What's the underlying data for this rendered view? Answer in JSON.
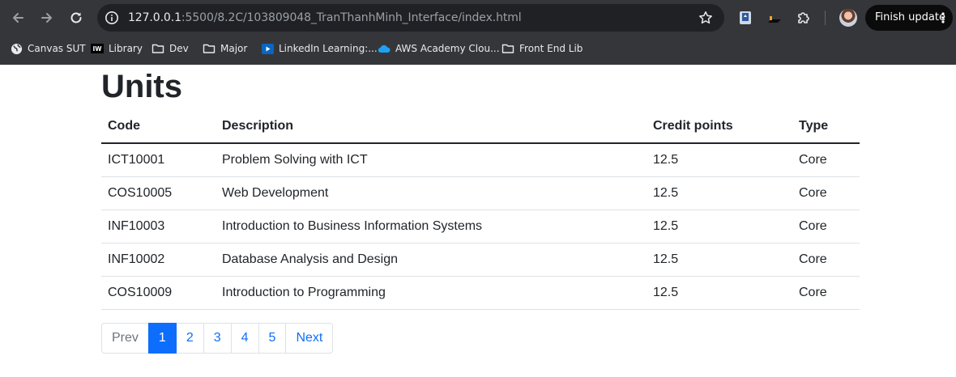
{
  "browser": {
    "url_host": "127.0.0.1",
    "url_path": ":5500/8.2C/103809048_TranThanhMinh_Interface/index.html",
    "finish_update_label": "Finish update",
    "bookmarks": [
      {
        "label": "Canvas SUT",
        "icon": "globe-icon"
      },
      {
        "label": "Library",
        "icon": "iw-logo-icon"
      },
      {
        "label": "Dev",
        "icon": "folder-icon"
      },
      {
        "label": "Major",
        "icon": "folder-icon"
      },
      {
        "label": "LinkedIn Learning:...",
        "icon": "play-icon"
      },
      {
        "label": "AWS Academy Clou...",
        "icon": "cloud-icon"
      },
      {
        "label": "Front End Lib",
        "icon": "folder-icon"
      }
    ],
    "iw_logo_text": "IW"
  },
  "page": {
    "title": "Units",
    "table": {
      "headers": [
        "Code",
        "Description",
        "Credit points",
        "Type"
      ],
      "rows": [
        [
          "ICT10001",
          "Problem Solving with ICT",
          "12.5",
          "Core"
        ],
        [
          "COS10005",
          "Web Development",
          "12.5",
          "Core"
        ],
        [
          "INF10003",
          "Introduction to Business Information Systems",
          "12.5",
          "Core"
        ],
        [
          "INF10002",
          "Database Analysis and Design",
          "12.5",
          "Core"
        ],
        [
          "COS10009",
          "Introduction to Programming",
          "12.5",
          "Core"
        ]
      ]
    },
    "pagination": {
      "prev": "Prev",
      "pages": [
        "1",
        "2",
        "3",
        "4",
        "5"
      ],
      "active_page": "1",
      "next": "Next"
    }
  },
  "colors": {
    "chrome_bg": "#35363a",
    "omnibox_bg": "#202124",
    "primary": "#0d6efd",
    "text": "#212529"
  }
}
